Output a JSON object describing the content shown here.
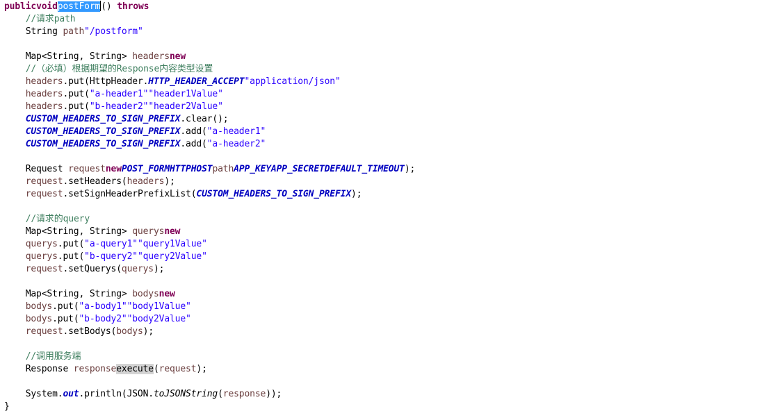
{
  "editor": {
    "lines": [
      [
        [
          "kw",
          "public"
        ],
        [
          "",
          ""
        ],
        [
          "",
          ""
        ],
        [
          "kw",
          "void"
        ],
        [
          "",
          ""
        ],
        [
          "sel",
          "postForm"
        ],
        [
          "caret",
          ""
        ],
        [
          "",
          "() "
        ],
        [
          "kw",
          "throws"
        ],
        [
          "",
          ""
        ],
        [
          "",
          ""
        ]
      ],
      [
        [
          "comment",
          "    //请求path"
        ]
      ],
      [
        [
          "",
          "    String "
        ],
        [
          "local",
          "path"
        ],
        [
          "",
          ""
        ],
        [
          "str",
          "\"/postform\""
        ],
        [
          "",
          ""
        ]
      ],
      [],
      [
        [
          "",
          "    Map<String, String> "
        ],
        [
          "local",
          "headers"
        ],
        [
          "",
          ""
        ],
        [
          "kw",
          "new"
        ],
        [
          "",
          ""
        ]
      ],
      [
        [
          "comment",
          "    //（必填）根据期望的Response内容类型设置"
        ]
      ],
      [
        [
          "",
          "    "
        ],
        [
          "local",
          "headers"
        ],
        [
          "",
          ".put(HttpHeader."
        ],
        [
          "sconst",
          "HTTP_HEADER_ACCEPT"
        ],
        [
          "",
          ""
        ],
        [
          "str",
          "\"application/json\""
        ],
        [
          "",
          ""
        ]
      ],
      [
        [
          "",
          "    "
        ],
        [
          "local",
          "headers"
        ],
        [
          "",
          ".put("
        ],
        [
          "str",
          "\"a-header1\""
        ],
        [
          "",
          ""
        ],
        [
          "str",
          "\"header1Value\""
        ],
        [
          "",
          ""
        ]
      ],
      [
        [
          "",
          "    "
        ],
        [
          "local",
          "headers"
        ],
        [
          "",
          ".put("
        ],
        [
          "str",
          "\"b-header2\""
        ],
        [
          "",
          ""
        ],
        [
          "str",
          "\"header2Value\""
        ],
        [
          "",
          ""
        ]
      ],
      [
        [
          "",
          "    "
        ],
        [
          "sconst",
          "CUSTOM_HEADERS_TO_SIGN_PREFIX"
        ],
        [
          "",
          ".clear();"
        ]
      ],
      [
        [
          "",
          "    "
        ],
        [
          "sconst",
          "CUSTOM_HEADERS_TO_SIGN_PREFIX"
        ],
        [
          "",
          ".add("
        ],
        [
          "str",
          "\"a-header1\""
        ],
        [
          "",
          ""
        ]
      ],
      [
        [
          "",
          "    "
        ],
        [
          "sconst",
          "CUSTOM_HEADERS_TO_SIGN_PREFIX"
        ],
        [
          "",
          ".add("
        ],
        [
          "str",
          "\"a-header2\""
        ],
        [
          "",
          ""
        ]
      ],
      [],
      [
        [
          "",
          "    Request "
        ],
        [
          "local",
          "request"
        ],
        [
          "",
          ""
        ],
        [
          "kw",
          "new"
        ],
        [
          "",
          ""
        ],
        [
          "sconst",
          "POST_FORM"
        ],
        [
          "",
          ""
        ],
        [
          "sconst",
          "HTTP"
        ],
        [
          "",
          ""
        ],
        [
          "sconst",
          "HOST"
        ],
        [
          "",
          ""
        ],
        [
          "local",
          "path"
        ],
        [
          "",
          ""
        ],
        [
          "sconst",
          "APP_KEY"
        ],
        [
          "",
          ""
        ],
        [
          "sconst",
          "APP_SECRET"
        ],
        [
          "",
          ""
        ],
        [
          "sconst",
          "DEFAULT_TIMEOUT"
        ],
        [
          "",
          ");"
        ]
      ],
      [
        [
          "",
          "    "
        ],
        [
          "local",
          "request"
        ],
        [
          "",
          ".setHeaders("
        ],
        [
          "local",
          "headers"
        ],
        [
          "",
          ");"
        ]
      ],
      [
        [
          "",
          "    "
        ],
        [
          "local",
          "request"
        ],
        [
          "",
          ".setSignHeaderPrefixList("
        ],
        [
          "sconst",
          "CUSTOM_HEADERS_TO_SIGN_PREFIX"
        ],
        [
          "",
          ");"
        ]
      ],
      [],
      [
        [
          "comment",
          "    //请求的query"
        ]
      ],
      [
        [
          "",
          "    Map<String, String> "
        ],
        [
          "local",
          "querys"
        ],
        [
          "",
          ""
        ],
        [
          "kw",
          "new"
        ],
        [
          "",
          ""
        ]
      ],
      [
        [
          "",
          "    "
        ],
        [
          "local",
          "querys"
        ],
        [
          "",
          ".put("
        ],
        [
          "str",
          "\"a-query1\""
        ],
        [
          "",
          ""
        ],
        [
          "str",
          "\"query1Value\""
        ],
        [
          "",
          ""
        ]
      ],
      [
        [
          "",
          "    "
        ],
        [
          "local",
          "querys"
        ],
        [
          "",
          ".put("
        ],
        [
          "str",
          "\"b-query2\""
        ],
        [
          "",
          ""
        ],
        [
          "str",
          "\"query2Value\""
        ],
        [
          "",
          ""
        ]
      ],
      [
        [
          "",
          "    "
        ],
        [
          "local",
          "request"
        ],
        [
          "",
          ".setQuerys("
        ],
        [
          "local",
          "querys"
        ],
        [
          "",
          ");"
        ]
      ],
      [],
      [
        [
          "",
          "    Map<String, String> "
        ],
        [
          "local",
          "bodys"
        ],
        [
          "",
          ""
        ],
        [
          "kw",
          "new"
        ],
        [
          "",
          ""
        ]
      ],
      [
        [
          "",
          "    "
        ],
        [
          "local",
          "bodys"
        ],
        [
          "",
          ".put("
        ],
        [
          "str",
          "\"a-body1\""
        ],
        [
          "",
          ""
        ],
        [
          "str",
          "\"body1Value\""
        ],
        [
          "",
          ""
        ]
      ],
      [
        [
          "",
          "    "
        ],
        [
          "local",
          "bodys"
        ],
        [
          "",
          ".put("
        ],
        [
          "str",
          "\"b-body2\""
        ],
        [
          "",
          ""
        ],
        [
          "str",
          "\"body2Value\""
        ],
        [
          "",
          ""
        ]
      ],
      [
        [
          "",
          "    "
        ],
        [
          "local",
          "request"
        ],
        [
          "",
          ".setBodys("
        ],
        [
          "local",
          "bodys"
        ],
        [
          "",
          ");"
        ]
      ],
      [],
      [
        [
          "comment",
          "    //调用服务端"
        ]
      ],
      [
        [
          "",
          "    Response "
        ],
        [
          "local",
          "response"
        ],
        [
          "",
          ""
        ],
        [
          "occ",
          "execute"
        ],
        [
          "",
          "("
        ],
        [
          "local",
          "request"
        ],
        [
          "",
          ");"
        ]
      ],
      [],
      [
        [
          "",
          "    System."
        ],
        [
          "sfield",
          "out"
        ],
        [
          "",
          ".println(JSON."
        ],
        [
          "static",
          "toJSONString"
        ],
        [
          "",
          "("
        ],
        [
          "local",
          "response"
        ],
        [
          "",
          "));"
        ]
      ],
      [
        [
          "",
          "}"
        ]
      ]
    ]
  }
}
